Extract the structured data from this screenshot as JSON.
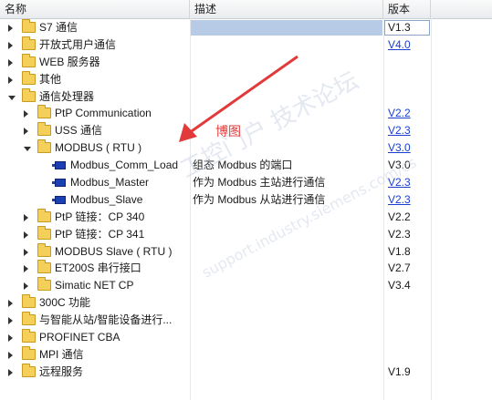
{
  "header": {
    "name": "名称",
    "description": "描述",
    "version": "版本"
  },
  "rows": [
    {
      "name": "S7 通信",
      "desc": "",
      "ver": "V1.3",
      "ver_link": false,
      "level": 0,
      "kind": "folder",
      "state": "collapsed",
      "highlight": true
    },
    {
      "name": "开放式用户通信",
      "desc": "",
      "ver": "V4.0",
      "ver_link": true,
      "level": 0,
      "kind": "folder",
      "state": "collapsed"
    },
    {
      "name": "WEB 服务器",
      "desc": "",
      "ver": "",
      "level": 0,
      "kind": "folder",
      "state": "collapsed"
    },
    {
      "name": "其他",
      "desc": "",
      "ver": "",
      "level": 0,
      "kind": "folder",
      "state": "collapsed"
    },
    {
      "name": "通信处理器",
      "desc": "",
      "ver": "",
      "level": 0,
      "kind": "folder",
      "state": "expanded"
    },
    {
      "name": "PtP Communication",
      "desc": "",
      "ver": "V2.2",
      "ver_link": true,
      "level": 1,
      "kind": "folder",
      "state": "collapsed"
    },
    {
      "name": "USS 通信",
      "desc": "",
      "ver": "V2.3",
      "ver_link": true,
      "level": 1,
      "kind": "folder",
      "state": "collapsed"
    },
    {
      "name": "MODBUS ( RTU )",
      "desc": "",
      "ver": "V3.0",
      "ver_link": true,
      "level": 1,
      "kind": "folder",
      "state": "expanded"
    },
    {
      "name": "Modbus_Comm_Load",
      "desc": "组态 Modbus 的端口",
      "ver": "V3.0",
      "ver_link": false,
      "level": 2,
      "kind": "block"
    },
    {
      "name": "Modbus_Master",
      "desc": "作为 Modbus 主站进行通信",
      "ver": "V2.3",
      "ver_link": true,
      "level": 2,
      "kind": "block"
    },
    {
      "name": "Modbus_Slave",
      "desc": "作为 Modbus 从站进行通信",
      "ver": "V2.3",
      "ver_link": true,
      "level": 2,
      "kind": "block"
    },
    {
      "name": "PtP 链接：CP 340",
      "desc": "",
      "ver": "V2.2",
      "ver_link": false,
      "level": 1,
      "kind": "folder",
      "state": "collapsed"
    },
    {
      "name": "PtP 链接：CP 341",
      "desc": "",
      "ver": "V2.3",
      "ver_link": false,
      "level": 1,
      "kind": "folder",
      "state": "collapsed"
    },
    {
      "name": "MODBUS Slave ( RTU )",
      "desc": "",
      "ver": "V1.8",
      "ver_link": false,
      "level": 1,
      "kind": "folder",
      "state": "collapsed"
    },
    {
      "name": "ET200S 串行接口",
      "desc": "",
      "ver": "V2.7",
      "ver_link": false,
      "level": 1,
      "kind": "folder",
      "state": "collapsed"
    },
    {
      "name": "Simatic NET CP",
      "desc": "",
      "ver": "V3.4",
      "ver_link": false,
      "level": 1,
      "kind": "folder",
      "state": "collapsed"
    },
    {
      "name": "300C 功能",
      "desc": "",
      "ver": "",
      "level": 0,
      "kind": "folder",
      "state": "collapsed"
    },
    {
      "name": "与智能从站/智能设备进行...",
      "desc": "",
      "ver": "",
      "level": 0,
      "kind": "folder",
      "state": "collapsed"
    },
    {
      "name": "PROFINET CBA",
      "desc": "",
      "ver": "",
      "level": 0,
      "kind": "folder",
      "state": "collapsed"
    },
    {
      "name": "MPI 通信",
      "desc": "",
      "ver": "",
      "level": 0,
      "kind": "folder",
      "state": "collapsed"
    },
    {
      "name": "远程服务",
      "desc": "",
      "ver": "V1.9",
      "ver_link": false,
      "level": 0,
      "kind": "folder",
      "state": "collapsed"
    }
  ],
  "annotation": {
    "text": "博图",
    "color": "#e23a3a"
  },
  "watermark": {
    "text": "工控门户 技术论坛",
    "url": "support.industry.siemens.com/cs"
  },
  "colors": {
    "highlight": "#b8cbe6",
    "link": "#1a3fd1",
    "folder": "#f4cf5a",
    "block": "#1c3fb3"
  }
}
